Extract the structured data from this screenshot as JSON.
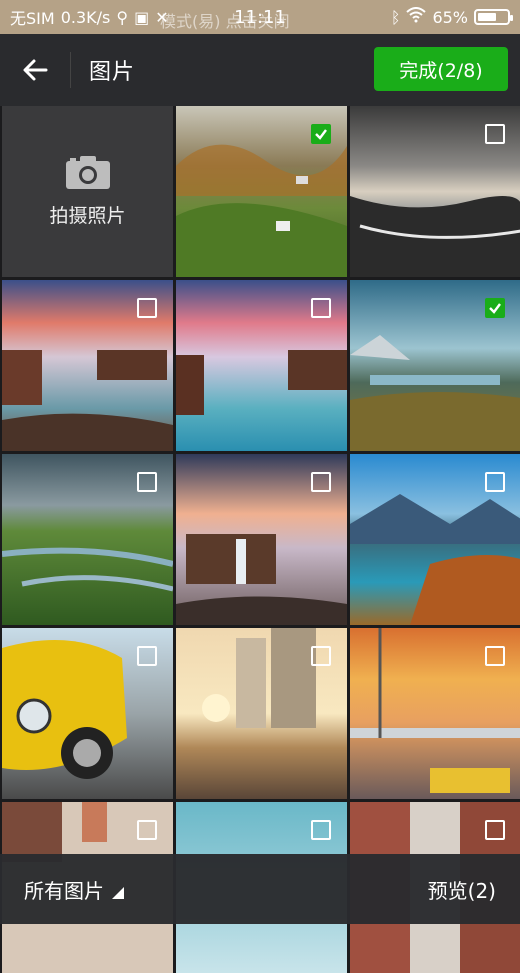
{
  "status_bar": {
    "carrier": "无SIM",
    "speed": "0.3K/s",
    "time": "11:11",
    "hint": "模式(易)    点击关闭",
    "battery": "65%",
    "battery_level": 0.65
  },
  "header": {
    "title": "图片",
    "done_label": "完成(2/8)"
  },
  "grid": {
    "camera_label": "拍摄照片",
    "photos": [
      {
        "name": "photo-village-hills",
        "checked": true
      },
      {
        "name": "photo-stormy-beach",
        "checked": false
      },
      {
        "name": "photo-waterfall-cliffs-1",
        "checked": false
      },
      {
        "name": "photo-waterfall-cliffs-2",
        "checked": false
      },
      {
        "name": "photo-lake-mountains",
        "checked": true
      },
      {
        "name": "photo-green-valley",
        "checked": false
      },
      {
        "name": "photo-waterfall-sunset",
        "checked": false
      },
      {
        "name": "photo-blue-lake-autumn",
        "checked": false
      },
      {
        "name": "photo-yellow-car",
        "checked": false
      },
      {
        "name": "photo-city-street",
        "checked": false
      },
      {
        "name": "photo-construction-sunset",
        "checked": false
      },
      {
        "name": "photo-runner-feet",
        "checked": false
      },
      {
        "name": "photo-sky-sea",
        "checked": false
      },
      {
        "name": "photo-brick-buildings",
        "checked": false
      }
    ]
  },
  "footer": {
    "folder_label": "所有图片",
    "preview_label": "预览(2)"
  },
  "colors": {
    "accent": "#1aad19",
    "bar": "#2a2b2e",
    "status": "#b5a287"
  }
}
